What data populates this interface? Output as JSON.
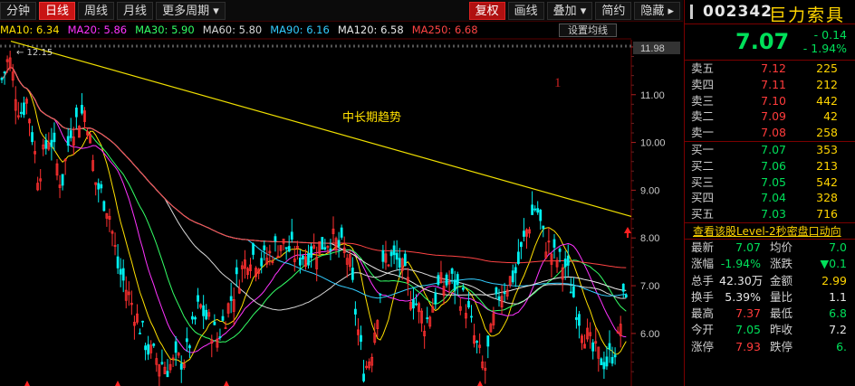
{
  "toolbar": {
    "items": [
      "分钟",
      "日线",
      "周线",
      "月线",
      "更多周期 ▾"
    ],
    "active": "日线",
    "right": [
      "复权",
      "画线",
      "叠加 ▾",
      "简约",
      "隐藏 ▸"
    ]
  },
  "ma_bar": [
    {
      "label": "MA10: 6.34",
      "color": "#ffe000"
    },
    {
      "label": "MA20: 5.86",
      "color": "#ff33ff"
    },
    {
      "label": "MA30: 5.90",
      "color": "#33ff66"
    },
    {
      "label": "MA60: 5.80",
      "color": "#d8d8d8"
    },
    {
      "label": "MA90: 6.16",
      "color": "#33ccff"
    },
    {
      "label": "MA120: 6.58",
      "color": "#e8e8e8"
    },
    {
      "label": "MA250: 6.68",
      "color": "#ff4444"
    }
  ],
  "ma_settings_label": "设置均线",
  "chart_data": {
    "type": "candlestick",
    "y_ticks": [
      "12.00",
      "11.00",
      "10.00",
      "9.00",
      "8.00",
      "7.00",
      "6.00"
    ],
    "ylim": [
      4.9,
      12.15
    ],
    "last_price_label": "11.98",
    "high_marker": "12.15",
    "trendline_label": "中长期趋势",
    "annotation": "1",
    "up_color": "#ff3030",
    "down_color": "#00f0f0"
  },
  "stock": {
    "code": "002342",
    "name": "巨力索具",
    "price": "7.07",
    "change": "- 0.14",
    "change_pct": "- 1.94%"
  },
  "sells": [
    {
      "label": "卖五",
      "price": "7.12",
      "vol": "225",
      "color": "#ff3b3b"
    },
    {
      "label": "卖四",
      "price": "7.11",
      "vol": "212",
      "color": "#ff3b3b"
    },
    {
      "label": "卖三",
      "price": "7.10",
      "vol": "442",
      "color": "#ff3b3b"
    },
    {
      "label": "卖二",
      "price": "7.09",
      "vol": "42",
      "color": "#ff3b3b"
    },
    {
      "label": "卖一",
      "price": "7.08",
      "vol": "258",
      "color": "#ff3b3b"
    }
  ],
  "buys": [
    {
      "label": "买一",
      "price": "7.07",
      "vol": "353",
      "color": "#00e05a"
    },
    {
      "label": "买二",
      "price": "7.06",
      "vol": "213",
      "color": "#00e05a"
    },
    {
      "label": "买三",
      "price": "7.05",
      "vol": "542",
      "color": "#00e05a"
    },
    {
      "label": "买四",
      "price": "7.04",
      "vol": "328",
      "color": "#00e05a"
    },
    {
      "label": "买五",
      "price": "7.03",
      "vol": "716",
      "color": "#00e05a"
    }
  ],
  "level2_link": "查看该股Level-2秒密盘口动向",
  "stats": [
    {
      "k": "最新",
      "v": "7.07",
      "vc": "#00e05a",
      "k2": "均价",
      "v2": "7.0",
      "v2c": "#00e05a"
    },
    {
      "k": "涨幅",
      "v": "-1.94%",
      "vc": "#00e05a",
      "k2": "涨跌",
      "v2": "▼0.1",
      "v2c": "#00e05a"
    },
    {
      "k": "总手",
      "v": "42.30万",
      "vc": "#e6e6e6",
      "k2": "金额",
      "v2": "2.99",
      "v2c": "#ffd400"
    },
    {
      "k": "换手",
      "v": "5.39%",
      "vc": "#e6e6e6",
      "k2": "量比",
      "v2": "1.1",
      "v2c": "#e6e6e6"
    },
    {
      "k": "最高",
      "v": "7.37",
      "vc": "#ff3b3b",
      "k2": "最低",
      "v2": "6.8",
      "v2c": "#00e05a"
    },
    {
      "k": "今开",
      "v": "7.05",
      "vc": "#00e05a",
      "k2": "昨收",
      "v2": "7.2",
      "v2c": "#e6e6e6"
    },
    {
      "k": "涨停",
      "v": "7.93",
      "vc": "#ff3b3b",
      "k2": "跌停",
      "v2": "6.",
      "v2c": "#00e05a"
    }
  ]
}
